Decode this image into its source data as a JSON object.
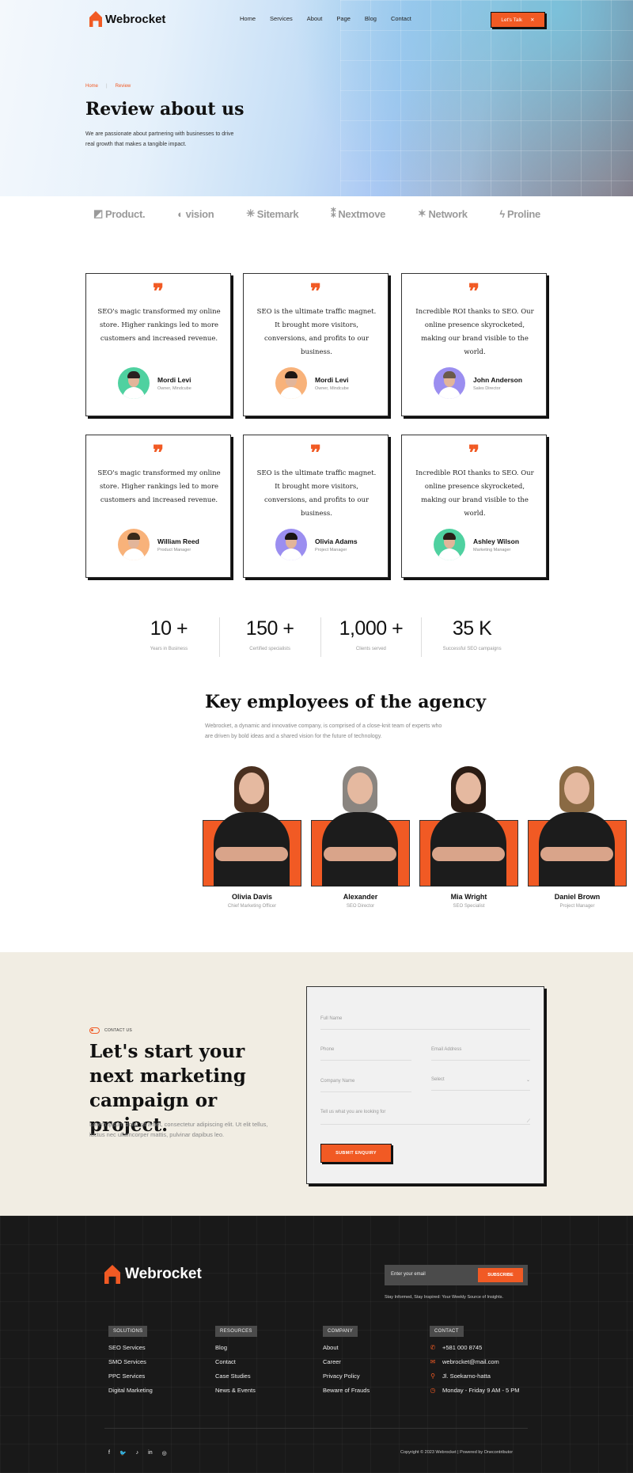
{
  "header": {
    "brand": "Webrocket",
    "nav": [
      "Home",
      "Services",
      "About",
      "Page",
      "Blog",
      "Contact"
    ],
    "cta_label": "Let's Talk",
    "cta_icon": "close-icon"
  },
  "hero": {
    "breadcrumb": [
      "Home",
      "Review"
    ],
    "title": "Review about us",
    "subtitle": "We are passionate about partnering with businesses to drive real growth that makes a tangible impact."
  },
  "brands": [
    {
      "name": "Product.",
      "icon": "product-logo-icon",
      "glyph": "◩"
    },
    {
      "name": "vision",
      "icon": "vision-logo-icon",
      "glyph": "◐"
    },
    {
      "name": "Sitemark",
      "icon": "sitemark-logo-icon",
      "glyph": "✳"
    },
    {
      "name": "Nextmove",
      "icon": "nextmove-logo-icon",
      "glyph": "⁑"
    },
    {
      "name": "Network",
      "icon": "network-logo-icon",
      "glyph": "✶"
    },
    {
      "name": "Proline",
      "icon": "proline-logo-icon",
      "glyph": "ϟ"
    }
  ],
  "testimonials": [
    {
      "text": "SEO's magic transformed my online store. Higher rankings led to more customers and increased revenue.",
      "name": "Mordi Levi",
      "role": "Owner, Mindcube",
      "avatar_bg": "#4fd1a0",
      "hair": "#2a2020"
    },
    {
      "text": "SEO is the ultimate traffic magnet. It brought more visitors, conversions, and profits to our business.",
      "name": "Mordi Levi",
      "role": "Owner, Mindcube",
      "avatar_bg": "#f8b27a",
      "hair": "#1f1713"
    },
    {
      "text": "Incredible ROI thanks to SEO. Our online presence skyrocketed, making our brand visible to the world.",
      "name": "John Anderson",
      "role": "Sales Director",
      "avatar_bg": "#9b8ef0",
      "hair": "#6b5a4a"
    },
    {
      "text": "SEO's magic transformed my online store. Higher rankings led to more customers and increased revenue.",
      "name": "William Reed",
      "role": "Product Manager",
      "avatar_bg": "#f8b27a",
      "hair": "#3a2a1a"
    },
    {
      "text": "SEO is the ultimate traffic magnet. It brought more visitors, conversions, and profits to our business.",
      "name": "Olivia Adams",
      "role": "Project Manager",
      "avatar_bg": "#9b8ef0",
      "hair": "#1a1414"
    },
    {
      "text": "Incredible ROI thanks to SEO. Our online presence skyrocketed, making our brand visible to the world.",
      "name": "Ashley Wilson",
      "role": "Marketing Manager",
      "avatar_bg": "#4fd1a0",
      "hair": "#2a1e18"
    }
  ],
  "stats": [
    {
      "value": "10 +",
      "label": "Years in Business"
    },
    {
      "value": "150 +",
      "label": "Certified specialists"
    },
    {
      "value": "1,000 +",
      "label": "Clients served"
    },
    {
      "value": "35 K",
      "label": "Successful SEO campaigns"
    }
  ],
  "employees": {
    "title": "Key employees of the agency",
    "subtitle": "Webrocket, a dynamic and innovative company, is comprised of a close-knit team of experts who are driven by bold ideas and a shared vision for the future of technology.",
    "people": [
      {
        "name": "Olivia Davis",
        "role": "Chief Marketing Officer",
        "hair": "#4a3020"
      },
      {
        "name": "Alexander",
        "role": "SEO Director",
        "hair": "#8a8580"
      },
      {
        "name": "Mia Wright",
        "role": "SEO Specialist",
        "hair": "#2a1c14"
      },
      {
        "name": "Daniel Brown",
        "role": "Project Manager",
        "hair": "#8a6a44"
      }
    ]
  },
  "contact": {
    "tag": "CONTACT US",
    "title": "Let's start your next marketing campaign or project.",
    "subtitle": "Lorem ipsum dolor sit amet, consectetur adipiscing elit. Ut elit tellus, luctus nec ullamcorper mattis, pulvinar dapibus leo.",
    "fields": {
      "full_name": "Full Name",
      "phone": "Phone",
      "email": "Email Address",
      "company": "Company  Name",
      "select": "Select",
      "message": "Tell us what you are looking for"
    },
    "submit_label": "SUBMIT ENQUIRY"
  },
  "footer": {
    "brand": "Webrocket",
    "newsletter_placeholder": "Enter your email",
    "subscribe_label": "SUBSCRIBE",
    "newsletter_note": "Stay Informed, Stay Inspired: Your Weekly Source of  Insights.",
    "columns": [
      {
        "heading": "SOLUTIONS",
        "links": [
          "SEO Services",
          "SMO Services",
          "PPC Services",
          "Digital Marketing"
        ]
      },
      {
        "heading": "RESOURCES",
        "links": [
          "Blog",
          "Contact",
          "Case Studies",
          "News & Events"
        ]
      },
      {
        "heading": "COMPANY",
        "links": [
          "About",
          "Career",
          "Privacy Policy",
          "Beware of Frauds"
        ]
      }
    ],
    "contact_heading": "CONTACT",
    "contact_items": [
      {
        "icon": "phone-icon",
        "glyph": "✆",
        "text": "+581 000 8745"
      },
      {
        "icon": "mail-icon",
        "glyph": "✉",
        "text": "webrocket@mail.com"
      },
      {
        "icon": "location-pin-icon",
        "glyph": "⚲",
        "text": "Jl. Soekarno-hatta"
      },
      {
        "icon": "clock-icon",
        "glyph": "◷",
        "text": "Monday - Friday 9 AM - 5 PM"
      }
    ],
    "socials": [
      {
        "icon": "facebook-icon",
        "glyph": "f"
      },
      {
        "icon": "twitter-icon",
        "glyph": "🐦"
      },
      {
        "icon": "tiktok-icon",
        "glyph": "♪"
      },
      {
        "icon": "linkedin-icon",
        "glyph": "in"
      },
      {
        "icon": "instagram-icon",
        "glyph": "◎"
      }
    ],
    "copyright": "Copyright © 2023 Webrocket | Powered by Onecontributor"
  },
  "colors": {
    "accent": "#f15a24",
    "footer_bg": "#191919",
    "contact_bg": "#f1ede3"
  }
}
